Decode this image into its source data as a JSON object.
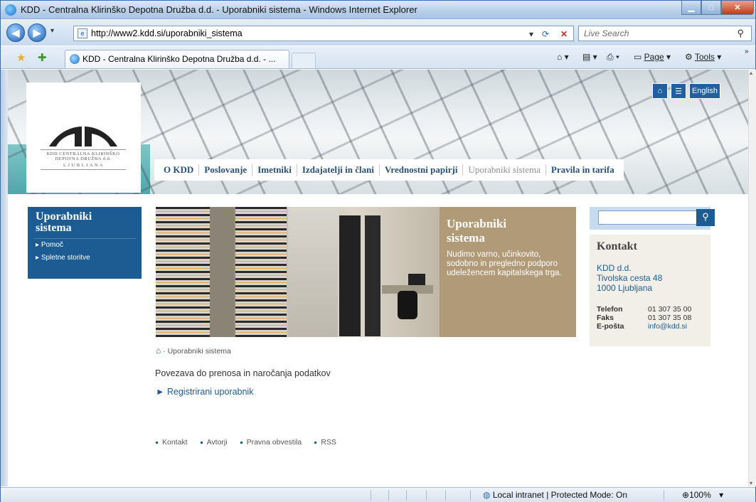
{
  "window": {
    "title": "KDD - Centralna Klirinško Depotna Družba d.d. - Uporabniki sistema - Windows Internet Explorer"
  },
  "address": {
    "url": "http://www2.kdd.si/uporabniki_sistema",
    "search_placeholder": "Live Search"
  },
  "tab": {
    "label": "KDD - Centralna Klirinško Depotna Družba d.d. - ..."
  },
  "commandbar": {
    "page": "Page",
    "tools": "Tools"
  },
  "site": {
    "logo": {
      "line1": "KDD CENTRALNA KLIRINŠKO",
      "line2": "DEPOTNA DRUŽBA d.d.",
      "line3": "L J U B L J A N A"
    },
    "english": "English",
    "menu": [
      "O KDD",
      "Poslovanje",
      "Imetniki",
      "Izdajatelji in člani",
      "Vrednostni papirji",
      "Uporabniki sistema",
      "Pravila in tarifa"
    ],
    "sidebar": {
      "title_1": "Uporabniki",
      "title_2": "sistema",
      "items": [
        "Pomoč",
        "Spletne storitve"
      ]
    },
    "hero": {
      "title_1": "Uporabniki",
      "title_2": "sistema",
      "text": "Nudimo varno, učinkovito, sodobno in pregledno podporo udeležencem kapitalskega trga."
    },
    "kontakt": {
      "title": "Kontakt",
      "addr1": "KDD d.d.",
      "addr2": "Tivolska cesta 48",
      "addr3": "1000 Ljubljana",
      "tel_label": "Telefon",
      "tel": "01 307 35 00",
      "fax_label": "Faks",
      "fax": "01 307 35 08",
      "mail_label": "E-pošta",
      "mail": "info@kdd.si"
    },
    "breadcrumb": "Uporabniki sistema",
    "paragraph": "Povezava do prenosa in naročanja podatkov",
    "link": "Registrirani uporabnik",
    "footer": [
      "Kontakt",
      "Avtorji",
      "Pravna obvestila",
      "RSS"
    ]
  },
  "status": {
    "zone": "Local intranet | Protected Mode: On",
    "zoom": "100%"
  },
  "colors": {
    "brand_blue": "#1d5c93",
    "hero_tan": "#b09a78",
    "kontakt_bg": "#f1efe7"
  }
}
